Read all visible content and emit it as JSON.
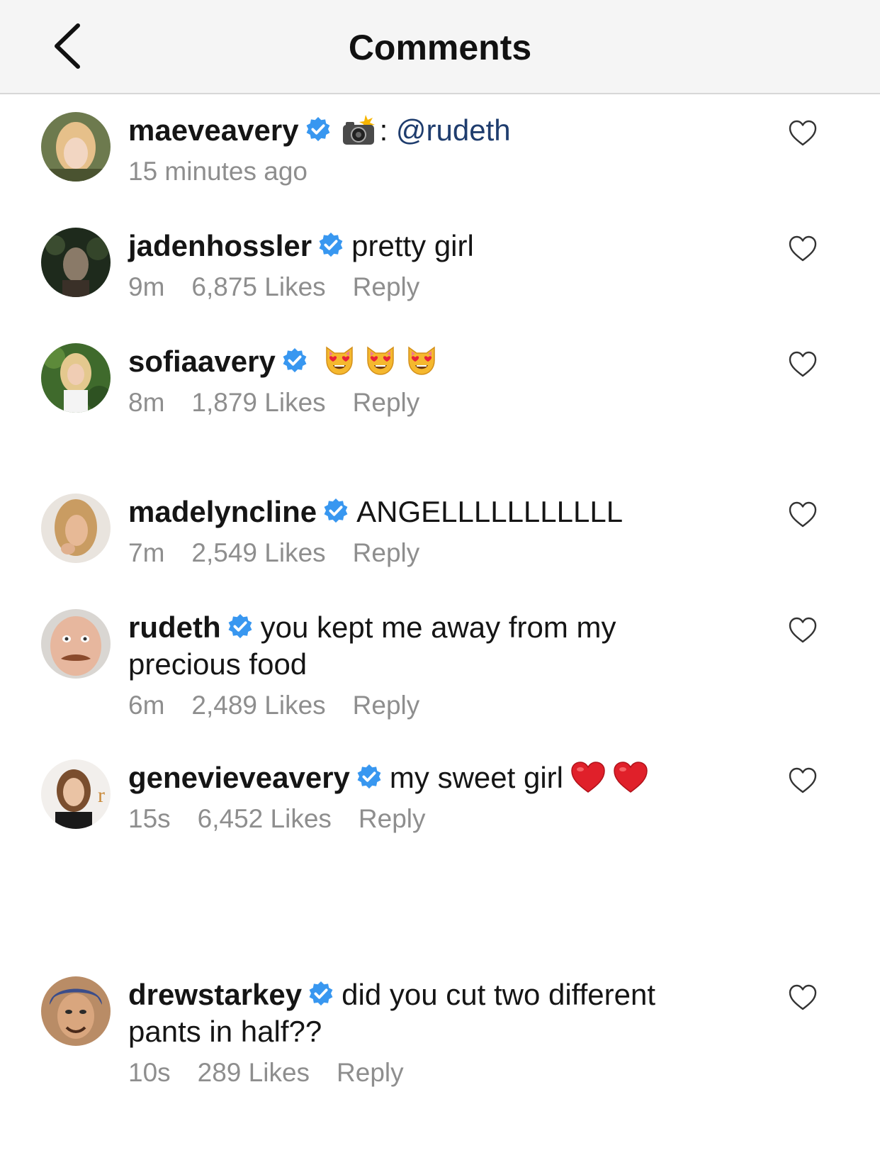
{
  "header": {
    "title": "Comments",
    "back_icon": "chevron-left-icon"
  },
  "comments": [
    {
      "username": "maeveavery",
      "verified": true,
      "prefix_icon": "camera-flash-icon",
      "text": ": ",
      "mention": "@rudeth",
      "time": "15 minutes ago"
    },
    {
      "username": "jadenhossler",
      "verified": true,
      "text": "pretty girl",
      "time": "9m",
      "likes": "6,875 Likes",
      "reply": "Reply"
    },
    {
      "username": "sofiaavery",
      "verified": true,
      "emoji": [
        "heart-eyes-cat-icon",
        "heart-eyes-cat-icon",
        "heart-eyes-cat-icon"
      ],
      "time": "8m",
      "likes": "1,879 Likes",
      "reply": "Reply"
    },
    {
      "username": "madelyncline",
      "verified": true,
      "text": "ANGELLLLLLLLLLL",
      "time": "7m",
      "likes": "2,549 Likes",
      "reply": "Reply"
    },
    {
      "username": "rudeth",
      "verified": true,
      "text": "you kept me away from my precious food",
      "time": "6m",
      "likes": "2,489 Likes",
      "reply": "Reply"
    },
    {
      "username": "genevieveavery",
      "verified": true,
      "text": "my sweet girl",
      "emoji": [
        "red-heart-icon",
        "red-heart-icon"
      ],
      "time": "15s",
      "likes": "6,452 Likes",
      "reply": "Reply"
    },
    {
      "username": "drewstarkey",
      "verified": true,
      "text": "did you cut two different pants in half??",
      "time": "10s",
      "likes": "289 Likes",
      "reply": "Reply"
    }
  ],
  "colors": {
    "verified": "#3897f0",
    "meta": "#8e8e8e",
    "mention": "#1f3d6e",
    "header_bg": "#f5f5f5"
  }
}
